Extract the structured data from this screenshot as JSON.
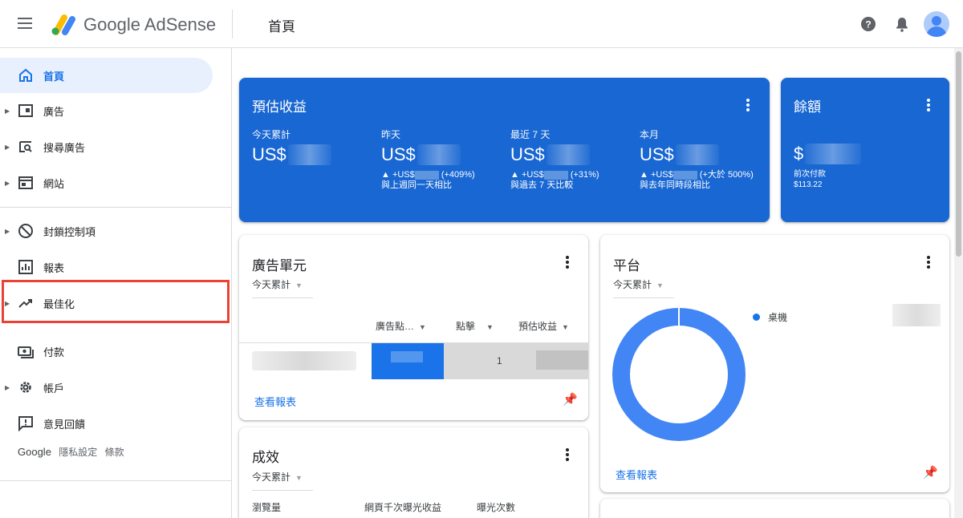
{
  "header": {
    "brand": "Google AdSense",
    "page_title": "首頁",
    "icons": [
      "menu-icon",
      "adsense-logo",
      "help-icon",
      "bell-icon",
      "account-avatar"
    ]
  },
  "sidebar": {
    "items": [
      {
        "label": "首頁",
        "icon": "home-icon",
        "active": true
      },
      {
        "label": "廣告",
        "icon": "ads-icon"
      },
      {
        "label": "搜尋廣告",
        "icon": "search-ads-icon"
      },
      {
        "label": "網站",
        "icon": "sites-icon"
      },
      {
        "label": "封鎖控制項",
        "icon": "block-icon"
      },
      {
        "label": "報表",
        "icon": "reports-icon"
      },
      {
        "label": "最佳化",
        "icon": "trending-icon"
      },
      {
        "label": "付款",
        "icon": "payments-icon",
        "highlighted": true
      },
      {
        "label": "帳戶",
        "icon": "gear-icon"
      },
      {
        "label": "意見回饋",
        "icon": "feedback-icon"
      }
    ],
    "footer": {
      "brand": "Google",
      "privacy": "隱私設定",
      "terms": "條款"
    }
  },
  "earnings": {
    "title": "預估收益",
    "stats": [
      {
        "label": "今天累計",
        "value": "US$",
        "delta": "",
        "compare": ""
      },
      {
        "label": "昨天",
        "value": "US$",
        "delta_prefix": "▲ +US$",
        "delta_suffix": "(+409%)",
        "compare": "與上週同一天相比"
      },
      {
        "label": "最近 7 天",
        "value": "US$",
        "delta_prefix": "▲ +US$",
        "delta_suffix": "(+31%)",
        "compare": "與過去 7 天比較"
      },
      {
        "label": "本月",
        "value": "US$",
        "delta_prefix": "▲ +US$",
        "delta_suffix": "(+大於 500%)",
        "compare": "與去年同時段相比"
      }
    ]
  },
  "balance": {
    "title": "餘額",
    "value": "$",
    "last_payment_label": "前次付款",
    "last_payment": "$113.22"
  },
  "ad_units": {
    "title": "廣告單元",
    "range": "今天累計",
    "columns": [
      "廣告點…",
      "點擊",
      "預估收益"
    ],
    "row": {
      "clicks": "1"
    },
    "link": "查看報表"
  },
  "platform": {
    "title": "平台",
    "range": "今天累計",
    "legend": "桌機",
    "link": "查看報表",
    "colors": {
      "donut": "#4285f4"
    }
  },
  "performance": {
    "title": "成效",
    "range": "今天累計",
    "columns": [
      "瀏覽量",
      "網頁千次曝光收益",
      "曝光次數"
    ]
  },
  "colors": {
    "primary": "#1a73e8",
    "card_blue": "#1967d2",
    "highlight": "#ea4335"
  }
}
